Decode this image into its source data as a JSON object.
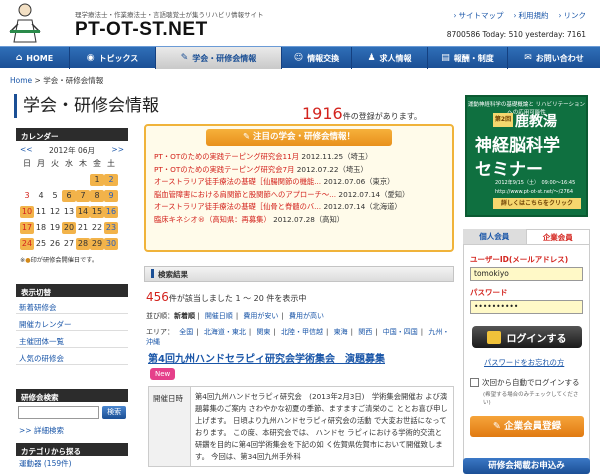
{
  "header": {
    "tagline": "理学療法士・作業療法士・言語聴覚士が集うリハビリ情報サイト",
    "site_title": "PT-OT-ST.NET",
    "top_links": [
      "サイトマップ",
      "利用規約",
      "リンク"
    ],
    "counter": "8700586 Today: 510 yesterday: 7161"
  },
  "nav": [
    {
      "label": "HOME",
      "icon": "home-icon",
      "glyph": "⌂"
    },
    {
      "label": "トピックス",
      "icon": "topics-icon",
      "glyph": "◉"
    },
    {
      "label": "学会・研修会情報",
      "icon": "pencil-icon",
      "glyph": "✎"
    },
    {
      "label": "情報交換",
      "icon": "chat-icon",
      "glyph": "☺"
    },
    {
      "label": "求人情報",
      "icon": "person-icon",
      "glyph": "♟"
    },
    {
      "label": "報酬・制度",
      "icon": "document-icon",
      "glyph": "▤"
    },
    {
      "label": "お問い合わせ",
      "icon": "mail-icon",
      "glyph": "✉"
    }
  ],
  "breadcrumb": {
    "home": "Home",
    "sep": ">",
    "current": "学会・研修会情報"
  },
  "page_title": "学会・研修会情報",
  "registration": {
    "count": "1916",
    "suffix": "件の登録があります。"
  },
  "calendar": {
    "heading": "カレンダー",
    "prev": "<<",
    "month": "2012年 06月",
    "next": ">>",
    "weekdays": [
      "日",
      "月",
      "火",
      "水",
      "木",
      "金",
      "土"
    ],
    "note_mark": "※",
    "note_text": "印が研修会開催日です。",
    "note_prefix": "※",
    "note_circle": "●"
  },
  "sidebar": {
    "display_heading": "表示切替",
    "display_items": [
      "新着研修会",
      "開催カレンダー",
      "主催団体一覧",
      "人気の研修会"
    ],
    "search_heading": "研修会検索",
    "search_button": "検索",
    "advanced": ">> 詳細検索",
    "category_heading": "カテゴリから探る",
    "category_first": "運動器 (159件)"
  },
  "notable": {
    "heading": "注目の学会・研修会情報！",
    "items": [
      {
        "title": "PT・OTのための実践テーピング研究会11月",
        "extra": "2012.11.25（埼玉）"
      },
      {
        "title": "PT・OTのための実践テーピング研究会7月",
        "extra": "2012.07.22（埼玉）"
      },
      {
        "title": "オーストラリア徒手療法の基礎［仙腸関節の機能...",
        "extra": "2012.07.06（東京）"
      },
      {
        "title": "脳血管障害における肩関節と股関節へのアプローチ～...",
        "extra": "2012.07.14（愛知）"
      },
      {
        "title": "オーストラリア徒手療法の基礎［仙骨と脊髄のバ...",
        "extra": "2012.07.14（北海道）"
      },
      {
        "title": "臨床キネシオ®（高知県：再募集）",
        "extra": "2012.07.28（高知）"
      }
    ]
  },
  "results": {
    "heading": "検索結果",
    "count": "456",
    "count_text": "件が該当しました 1 ～ 20 件を表示中",
    "sort_label": "並び順：",
    "sort_current": "新着順",
    "sort_options": [
      "開催日順",
      "費用が安い",
      "費用が高い"
    ],
    "area_label": "エリア：",
    "areas": [
      "全国",
      "北海道・東北",
      "関東",
      "北陸・甲信越",
      "東海",
      "関西",
      "中国・四国",
      "九州・沖縄"
    ]
  },
  "event": {
    "title": "第4回九州ハンドセラピィ研究会学術集会　演題募集",
    "badge": "New",
    "date_label": "開催日時",
    "description": "第4回九州ハンドセラピィ研究会　(2013年2月3日)　学術集会開催お よび演題募集のご案内 さわやかな初夏の季節、ますますご清栄のこ ととお喜び申し上げます。 日頃より九州ハンドセラピィ研究会の活動 で大変お世話になっております。 この度、本研究会では、 ハンドセ ラピィにおける学術的交流と研鑽を目的に第4回学術集会を下記の如 く佐賀県佐賀市において開催致します。 今回は、第34回九州手外科"
  },
  "banner": {
    "top": "運動神経科学の基礎概論と リハビリテーションへの応用可能性",
    "badge": "第2回",
    "title1": "鹿教湯",
    "title2": "神経脳科学",
    "title3": "セミナー",
    "date": "2012年9/15（土）　09:00〜16:45",
    "url": "http://www.pt-ot-st.net/～/2764",
    "button": "詳しくはこちらをクリック"
  },
  "login": {
    "tab_personal": "個人会員",
    "tab_corporate": "企業会員",
    "user_label": "ユーザーID(メールアドレス)",
    "user_value": "tomokiyo",
    "password_label": "パスワード",
    "password_value": "••••••••••",
    "login_button": "ログインする",
    "forgot": "パスワードをお忘れの方",
    "auto_login": "次回から自動でログインする",
    "auto_note": "(希望する場合のみチェックしてください)",
    "corp_button": "企業会員登録",
    "apply_button": "研修会掲載お申込み"
  }
}
